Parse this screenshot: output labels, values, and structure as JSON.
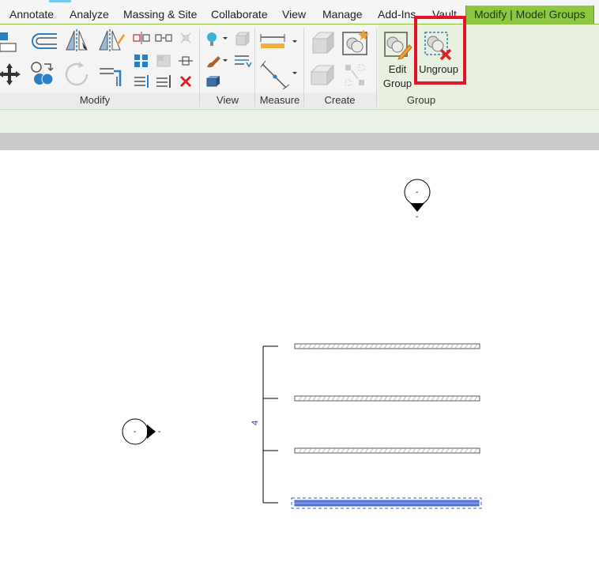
{
  "tabs": [
    {
      "label": "Annotate"
    },
    {
      "label": "Analyze"
    },
    {
      "label": "Massing & Site"
    },
    {
      "label": "Collaborate"
    },
    {
      "label": "View"
    },
    {
      "label": "Manage"
    },
    {
      "label": "Add-Ins"
    },
    {
      "label": "Vault"
    },
    {
      "label": "Modify | Model Groups"
    }
  ],
  "ribbon": {
    "groups": {
      "modify": "Modify",
      "view": "View",
      "measure": "Measure",
      "create": "Create",
      "group": "Group"
    },
    "edit_group_label_1": "Edit",
    "edit_group_label_2": "Group",
    "ungroup_label": "Ungroup"
  },
  "canvas": {
    "section_tag_top": "-",
    "section_tag_top_sub": "-",
    "section_tag_left": "-",
    "section_tag_left_sub": "-",
    "dimension_value": "4"
  },
  "colors": {
    "active_tab": "#8dc63f",
    "highlight": "#e2162a",
    "selection": "#3a62d6"
  }
}
